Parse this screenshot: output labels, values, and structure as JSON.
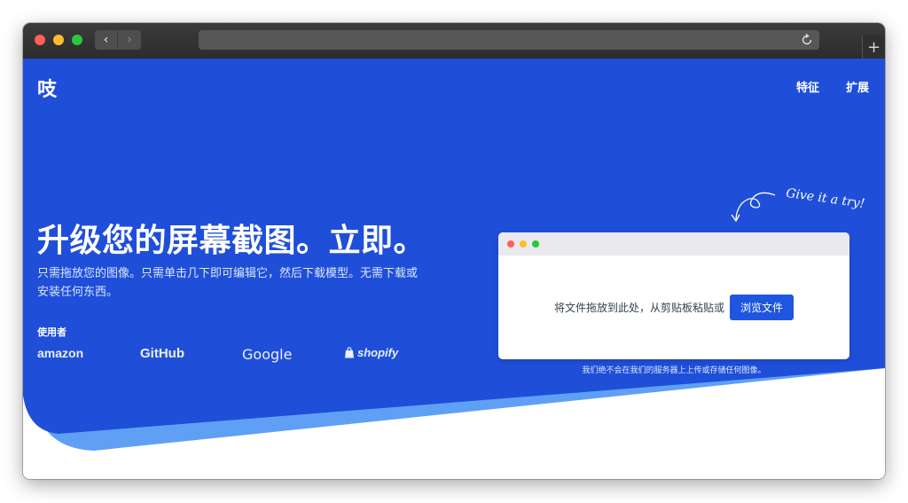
{
  "browser": {
    "back_glyph": "‹",
    "forward_glyph": "›",
    "newtab_glyph": "+"
  },
  "header": {
    "logo": "吱",
    "nav": [
      "特征",
      "扩展"
    ]
  },
  "hero": {
    "headline": "升级您的屏幕截图。立即。",
    "subtext": "只需拖放您的图像。只需单击几下即可编辑它，然后下载模型。无需下载或安装任何东西。",
    "used_by_label": "使用者",
    "brands": [
      "amazon",
      "GitHub",
      "Google",
      "shopify"
    ]
  },
  "dropzone": {
    "try_label": "Give it a try!",
    "prompt": "将文件拖放到此处，从剪贴板粘贴或",
    "browse_label": "浏览文件",
    "privacy_note": "我们绝不会在我们的服务器上上传或存储任何图像。"
  },
  "colors": {
    "brand_blue": "#1f4fd8",
    "accent_light_blue": "#5fa0f5",
    "button_blue": "#1f56e0"
  }
}
